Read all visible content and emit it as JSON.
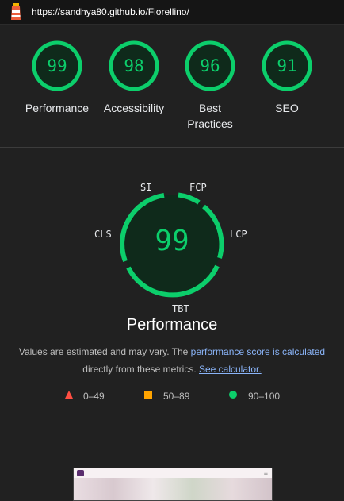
{
  "url": "https://sandhya80.github.io/Fiorellino/",
  "colors": {
    "pass": "#0cce6b",
    "average": "#ffa400",
    "fail": "#ff4e42",
    "link": "#8ab4f8"
  },
  "gauges": [
    {
      "label": "Performance",
      "score": "99"
    },
    {
      "label": "Accessibility",
      "score": "98"
    },
    {
      "label": "Best Practices",
      "score": "96"
    },
    {
      "label": "SEO",
      "score": "91"
    }
  ],
  "performance": {
    "score": "99",
    "title": "Performance",
    "metrics": {
      "si": "SI",
      "fcp": "FCP",
      "lcp": "LCP",
      "tbt": "TBT",
      "cls": "CLS"
    }
  },
  "note": {
    "text1": "Values are estimated and may vary. The ",
    "link1": "performance score is calculated",
    "text2": " directly from these metrics. ",
    "link2": "See calculator."
  },
  "legend": [
    {
      "icon": "triangle-icon",
      "range": "0–49"
    },
    {
      "icon": "square-icon",
      "range": "50–89"
    },
    {
      "icon": "circle-icon",
      "range": "90–100"
    }
  ]
}
